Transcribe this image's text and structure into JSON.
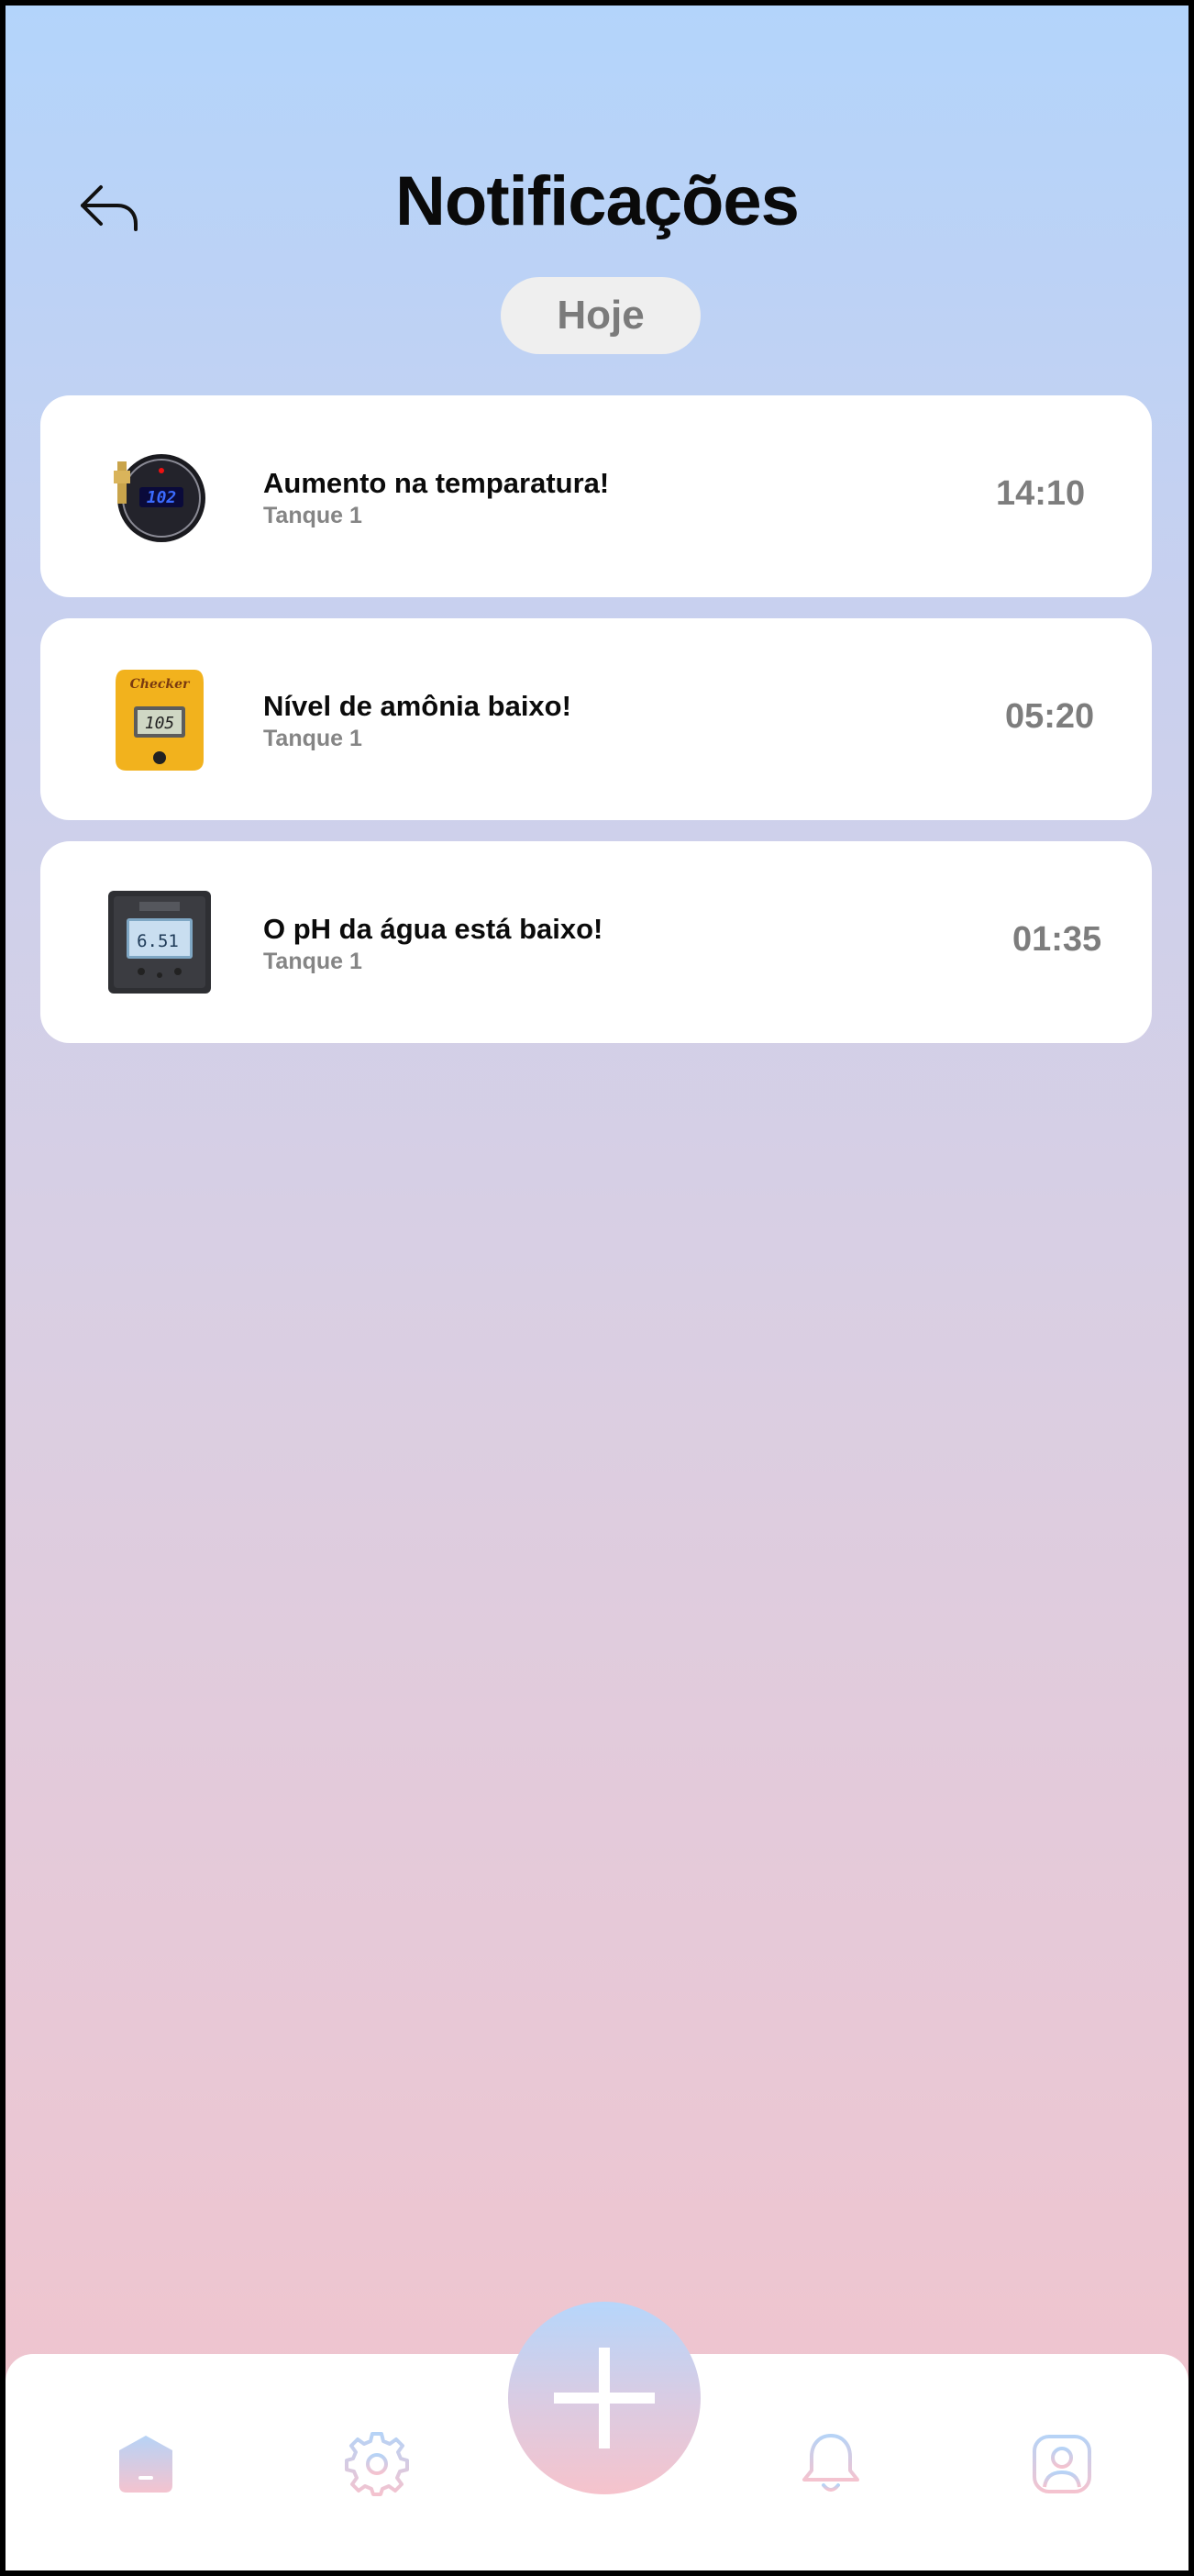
{
  "header": {
    "title": "Notificações",
    "back_icon": "reply-arrow-icon"
  },
  "filter": {
    "label": "Hoje"
  },
  "notifications": [
    {
      "title": "Aumento na temparatura!",
      "subtitle": "Tanque 1",
      "time": "14:10",
      "thumbnail": "thermometer-gauge",
      "thumb_reading": "102"
    },
    {
      "title": "Nível de amônia baixo!",
      "subtitle": "Tanque 1",
      "time": "05:20",
      "thumbnail": "ammonia-checker",
      "thumb_reading": "105"
    },
    {
      "title": "O pH da água está baixo!",
      "subtitle": "Tanque 1",
      "time": "01:35",
      "thumbnail": "ph-controller",
      "thumb_reading": "6.51"
    }
  ],
  "bottom_nav": {
    "items": [
      "home-icon",
      "gear-icon",
      "plus-icon",
      "bell-icon",
      "profile-icon"
    ]
  },
  "colors": {
    "gradient_top": "#b3d4fb",
    "gradient_bottom": "#f3c3cb",
    "nav_blue": "#b6d3f6",
    "nav_pink": "#f4c3cf"
  }
}
